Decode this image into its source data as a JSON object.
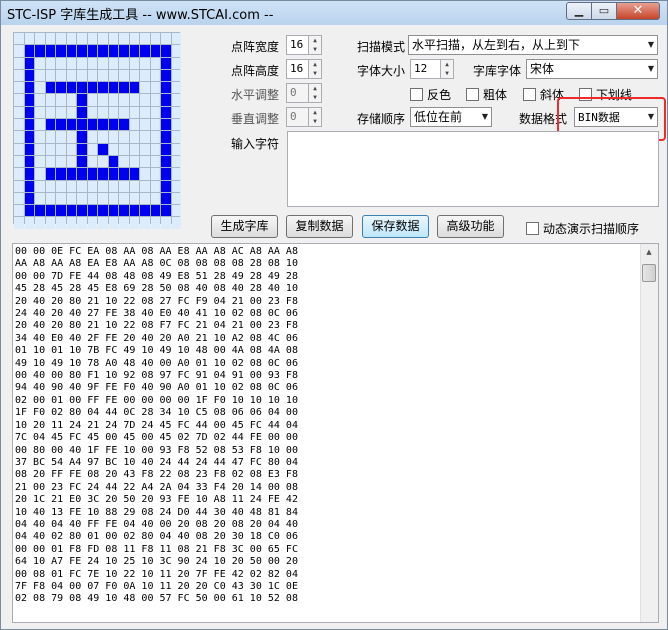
{
  "window": {
    "title": "STC-ISP 字库生成工具 -- www.STCAI.com --",
    "min_icon": "minimize-icon",
    "max_icon": "maximize-icon",
    "close_icon": "close-icon",
    "min_glyph": "▁",
    "max_glyph": "▭",
    "close_glyph": "✕"
  },
  "preview": {
    "rows": 16,
    "cols": 16,
    "bitmap": [
      "0000000000000000",
      "0111111111111110",
      "0100000000000010",
      "0100000000000010",
      "0101111111110010",
      "0100001000000010",
      "0100001000000010",
      "0101111111100010",
      "0100001000000010",
      "0100001010000010",
      "0100001001000010",
      "0101111111110010",
      "0100000000000010",
      "0100000000000010",
      "0111111111111110",
      "0000000000000000"
    ],
    "on_color": "#0000f0",
    "off_color": "#dcecfb"
  },
  "settings": {
    "width_label": "点阵宽度",
    "width_value": "16",
    "height_label": "点阵高度",
    "height_value": "16",
    "h_adjust_label": "水平调整",
    "h_adjust_value": "0",
    "v_adjust_label": "垂直调整",
    "v_adjust_value": "0",
    "scan_mode_label": "扫描模式",
    "scan_mode_value": "水平扫描，从左到右，从上到下",
    "font_size_label": "字体大小",
    "font_size_value": "12",
    "font_label": "字库字体",
    "font_value": "宋体",
    "inverse_label": "反色",
    "bold_label": "粗体",
    "italic_label": "斜体",
    "underline_label": "下划线",
    "storage_order_label": "存储顺序",
    "storage_order_value": "低位在前",
    "data_format_label": "数据格式",
    "data_format_value": "BIN数据",
    "input_label": "输入字符",
    "input_value": ""
  },
  "actions": {
    "generate": "生成字库",
    "copy": "复制数据",
    "save": "保存数据",
    "advanced": "高级功能",
    "demo_scan_label": "动态演示扫描顺序"
  },
  "hex_lines": [
    "00 00 0E FC EA 08 AA 08 AA E8 AA A8 AC A8 AA A8",
    "AA A8 AA A8 EA E8 AA A8 0C 08 08 08 08 28 08 10",
    "00 00 7D FE 44 08 48 08 49 E8 51 28 49 28 49 28",
    "45 28 45 28 45 E8 69 28 50 08 40 08 40 28 40 10",
    "20 40 20 80 21 10 22 08 27 FC F9 04 21 00 23 F8",
    "24 40 20 40 27 FE 38 40 E0 40 41 10 02 08 0C 06",
    "20 40 20 80 21 10 22 08 F7 FC 21 04 21 00 23 F8",
    "34 40 E0 40 2F FE 20 40 20 A0 21 10 A2 08 4C 06",
    "01 10 01 10 7B FC 49 10 49 10 48 00 4A 08 4A 08",
    "49 10 49 10 78 A0 48 40 00 A0 01 10 02 08 0C 06",
    "00 40 00 80 F1 10 92 08 97 FC 91 04 91 00 93 F8",
    "94 40 90 40 9F FE F0 40 90 A0 01 10 02 08 0C 06",
    "02 00 01 00 FF FE 00 00 00 00 1F F0 10 10 10 10",
    "1F F0 02 80 04 44 0C 28 34 10 C5 08 06 06 04 00",
    "10 20 11 24 21 24 7D 24 45 FC 44 00 45 FC 44 04",
    "7C 04 45 FC 45 00 45 00 45 02 7D 02 44 FE 00 00",
    "00 80 00 40 1F FE 10 00 93 F8 52 08 53 F8 10 00",
    "37 BC 54 A4 97 BC 10 40 24 44 24 44 47 FC 80 04",
    "08 20 FF FE 08 20 43 F8 22 08 23 F8 02 08 E3 F8",
    "21 00 23 FC 24 44 22 A4 2A 04 33 F4 20 14 00 08",
    "20 1C 21 E0 3C 20 50 20 93 FE 10 A8 11 24 FE 42",
    "10 40 13 FE 10 88 29 08 24 D0 44 30 40 48 81 84",
    "04 40 04 40 FF FE 04 40 00 20 08 20 08 20 04 40",
    "04 40 02 80 01 00 02 80 04 40 08 20 30 18 C0 06",
    "00 00 01 F8 FD 08 11 F8 11 08 21 F8 3C 00 65 FC",
    "64 10 A7 FE 24 10 25 10 3C 90 24 10 20 50 00 20",
    "00 08 01 FC 7E 10 22 10 11 20 7F FE 42 02 82 04",
    "7F F8 04 00 07 F0 0A 10 11 20 20 C0 43 30 1C 0E",
    "02 08 79 08 49 10 48 00 57 FC 50 00 61 10 52 08"
  ],
  "accent": {
    "highlight": "#ee2a2a",
    "active_button": "#3c7fb1"
  }
}
